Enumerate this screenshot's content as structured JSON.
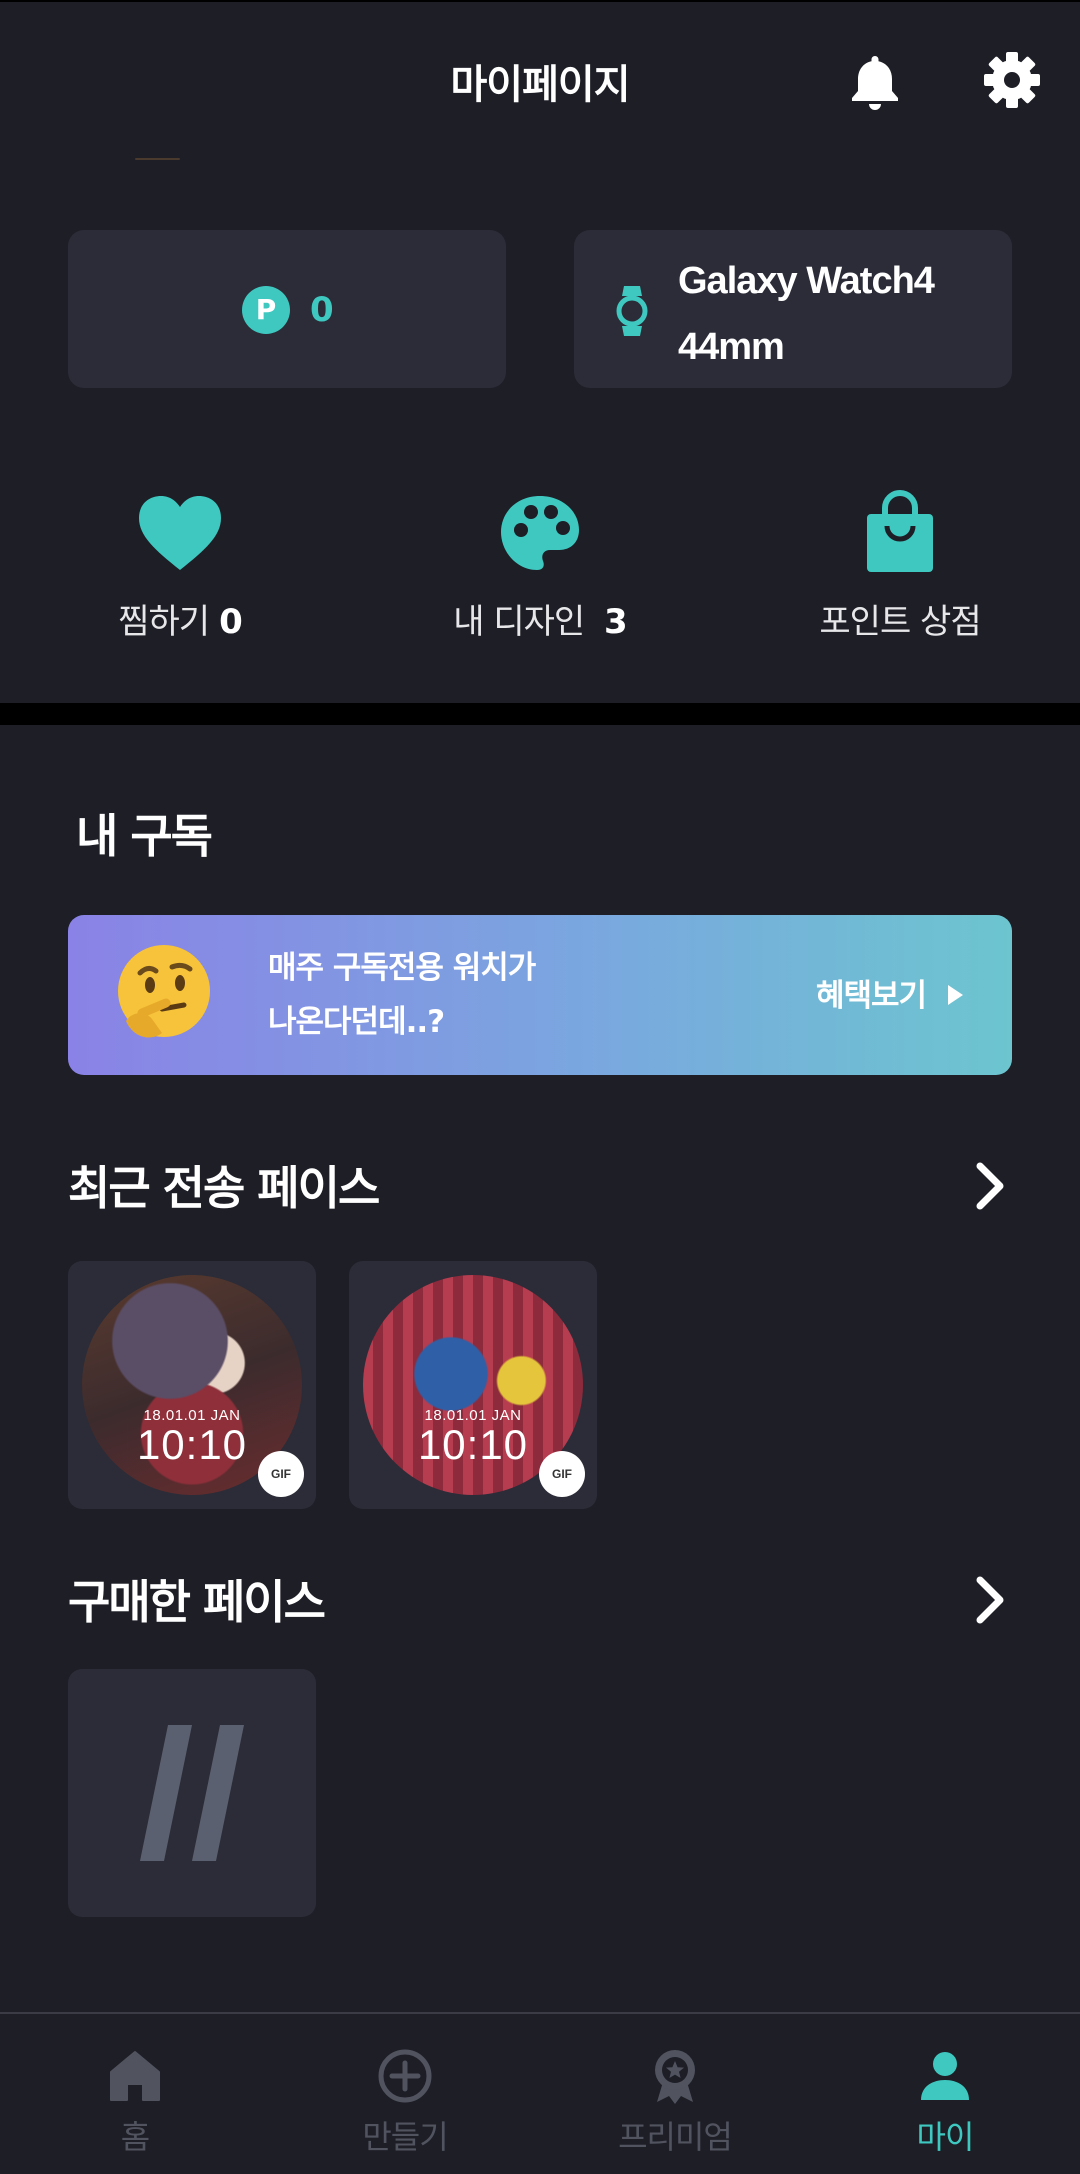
{
  "header": {
    "title": "마이페이지",
    "bell_icon": "bell-icon",
    "settings_icon": "gear-icon"
  },
  "points_card": {
    "icon": "p-badge-icon",
    "badge_letter": "P",
    "value": "0"
  },
  "device_card": {
    "icon": "watch-icon",
    "name": "Galaxy Watch4 44mm"
  },
  "quick_actions": [
    {
      "icon": "heart-icon",
      "label": "찜하기",
      "count": "0"
    },
    {
      "icon": "palette-icon",
      "label": "내 디자인",
      "count": "3"
    },
    {
      "icon": "shopping-bag-icon",
      "label": "포인트 상점"
    }
  ],
  "subscription": {
    "title": "내 구독",
    "banner_line1": "매주 구독전용 워치가",
    "banner_line2": "나온다던데..?",
    "cta": "혜택보기",
    "emoji": "thinking-face-emoji"
  },
  "recent_faces": {
    "title": "최근 전송 페이스",
    "items": [
      {
        "date": "18.01.01 JAN",
        "time": "10:10",
        "badge": "GIF"
      },
      {
        "date": "18.01.01 JAN",
        "time": "10:10",
        "badge": "GIF"
      }
    ]
  },
  "purchased_faces": {
    "title": "구매한 페이스"
  },
  "bottom_nav": {
    "items": [
      {
        "label": "홈",
        "icon": "home-icon"
      },
      {
        "label": "만들기",
        "icon": "plus-circle-icon"
      },
      {
        "label": "프리미엄",
        "icon": "award-icon"
      },
      {
        "label": "마이",
        "icon": "person-icon",
        "active": true
      }
    ]
  },
  "colors": {
    "accent": "#3ec8c0",
    "background": "#1d1e26",
    "card": "#2b2c37",
    "inactive": "#51535f"
  }
}
